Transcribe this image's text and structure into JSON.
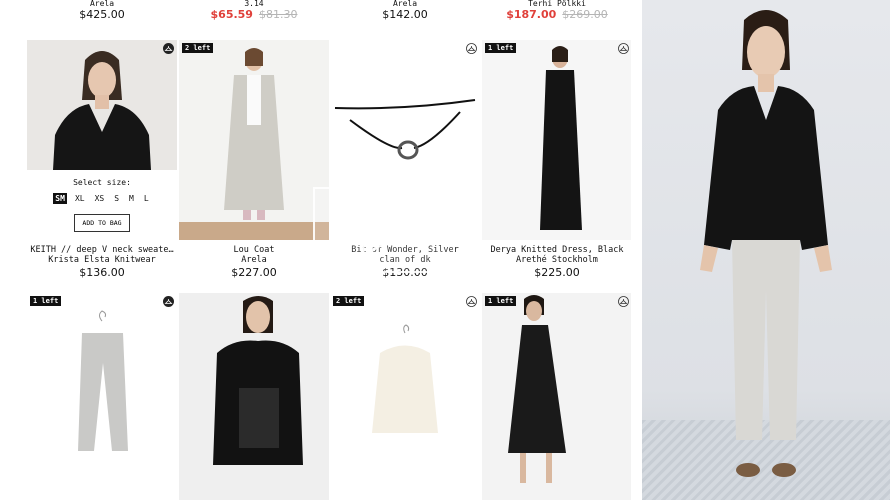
{
  "top_row": [
    {
      "name": "Arela",
      "price": "$425.00"
    },
    {
      "name": "3.14",
      "price": "$65.59",
      "old_price": "$81.30",
      "sale": true
    },
    {
      "name": "Arela",
      "price": "$142.00"
    },
    {
      "name": "Terhi Pölkki",
      "price": "$187.00",
      "old_price": "$269.00",
      "sale": true
    }
  ],
  "products": [
    {
      "name": "KEITH // deep V neck sweate…",
      "brand": "Krista Elsta Knitwear",
      "price": "$136.00",
      "badge": ""
    },
    {
      "name": "Lou Coat",
      "brand": "Arela",
      "price": "$227.00",
      "badge": "2 left"
    },
    {
      "name": "Bit of Wonder, Silver",
      "brand": "clan of dk",
      "price": "$130.00",
      "badge": ""
    },
    {
      "name": "Derya Knitted Dress, Black",
      "brand": "Arethé Stockholm",
      "price": "$225.00",
      "badge": "1 left"
    }
  ],
  "row2_badges": [
    "1 left",
    "",
    "2 left",
    "1 left"
  ],
  "size_picker": {
    "title": "Select size:",
    "sizes": [
      "SM",
      "XL",
      "XS",
      "S",
      "M",
      "L"
    ],
    "selected": "SM",
    "add_to_bag": "ADD TO BAG"
  },
  "colors": {
    "sale": "#e0403a",
    "badge": "#111111"
  },
  "icons": {
    "hanger": "hanger-icon",
    "play": "play-icon"
  }
}
